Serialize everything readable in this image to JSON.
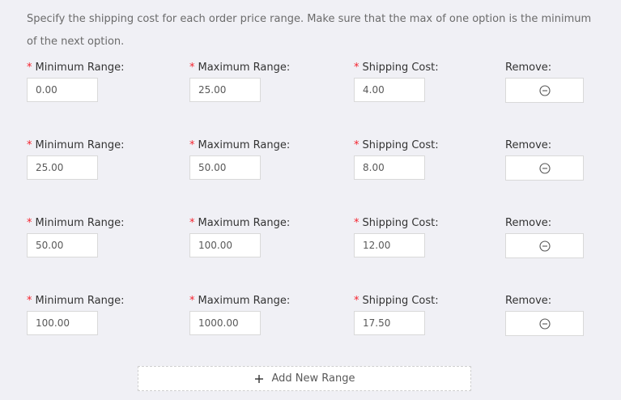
{
  "description": "Specify the shipping cost for each order price range. Make sure that the max of one option is the minimum of the next option.",
  "labels": {
    "required_mark": "*",
    "min": "Minimum Range:",
    "max": "Maximum Range:",
    "cost": "Shipping Cost:",
    "remove": "Remove:"
  },
  "ranges": [
    {
      "min": "0.00",
      "max": "25.00",
      "cost": "4.00"
    },
    {
      "min": "25.00",
      "max": "50.00",
      "cost": "8.00"
    },
    {
      "min": "50.00",
      "max": "100.00",
      "cost": "12.00"
    },
    {
      "min": "100.00",
      "max": "1000.00",
      "cost": "17.50"
    }
  ],
  "icons": {
    "remove": "minus-circle-icon",
    "add": "plus-icon"
  },
  "add_button_label": "Add New Range",
  "colors": {
    "required": "#f5222d",
    "background": "#f0f0f5",
    "border": "#d9d9d9"
  }
}
